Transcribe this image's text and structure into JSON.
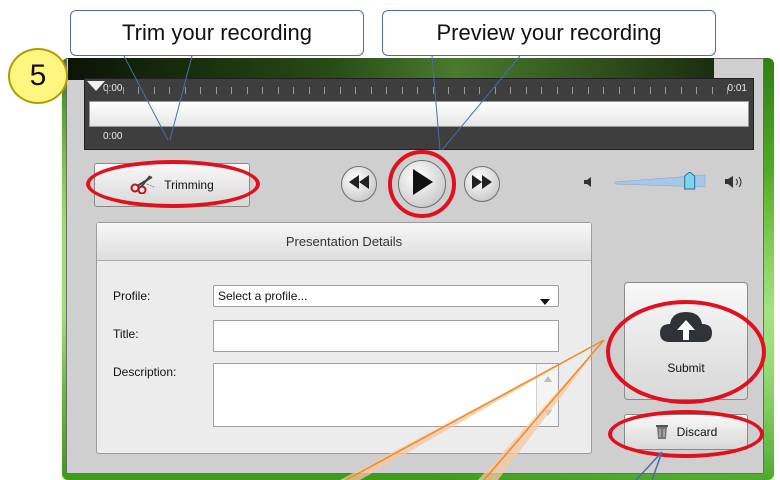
{
  "step_badge": "5",
  "callouts": {
    "trim": "Trim your recording",
    "preview": "Preview your recording"
  },
  "timeline": {
    "start_time": "0:00",
    "end_time": "0:01",
    "current_time": "0:00"
  },
  "toolbar": {
    "trimming_label": "Trimming"
  },
  "details": {
    "header": "Presentation Details",
    "profile_label": "Profile:",
    "profile_value": "Select a profile...",
    "title_label": "Title:",
    "title_value": "",
    "description_label": "Description:",
    "description_value": ""
  },
  "actions": {
    "submit_label": "Submit",
    "discard_label": "Discard"
  },
  "volume_level": 0.85,
  "colors": {
    "highlight": "#e0101e",
    "callout_border": "#4a6ea8",
    "badge": "#fff680",
    "arrow_orange": "#f08a24"
  }
}
